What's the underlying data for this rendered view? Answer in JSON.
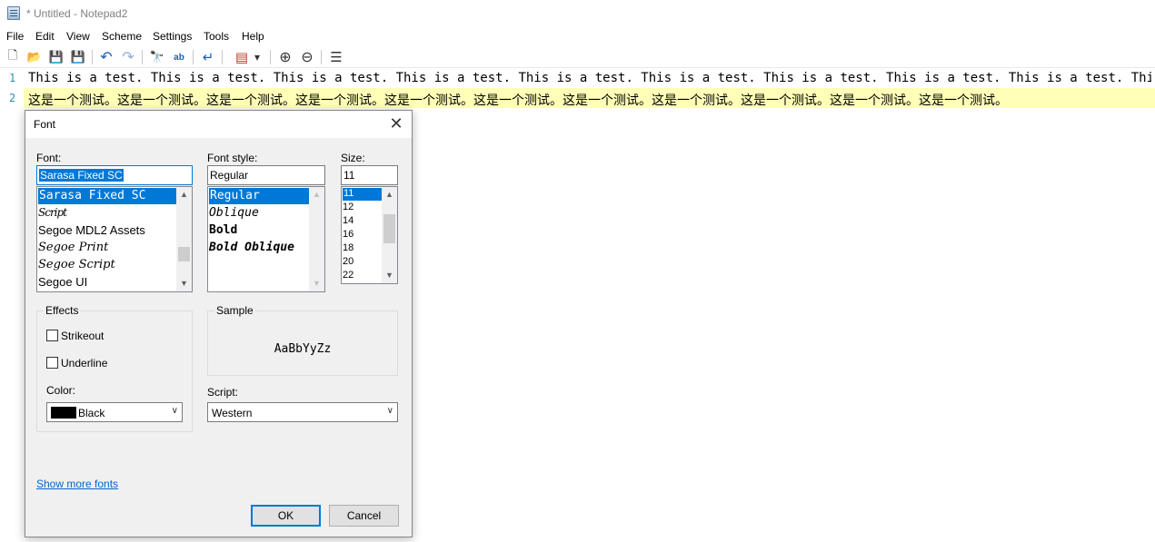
{
  "window": {
    "title": "* Untitled - Notepad2",
    "icon": "notepad-icon"
  },
  "menu": [
    "File",
    "Edit",
    "View",
    "Scheme",
    "Settings",
    "Tools",
    "Help"
  ],
  "toolbar": {
    "buttons": [
      {
        "name": "new-file-button",
        "icon": "new-file-icon",
        "glyph": "🗋"
      },
      {
        "name": "open-file-button",
        "icon": "open-folder-icon",
        "glyph": "📂"
      },
      {
        "name": "save-button",
        "icon": "save-icon",
        "glyph": "💾"
      },
      {
        "name": "save-as-button",
        "icon": "save-as-icon",
        "glyph": "💾"
      },
      {
        "name": "undo-button",
        "icon": "undo-icon",
        "glyph": "↶"
      },
      {
        "name": "redo-button",
        "icon": "redo-icon",
        "glyph": "↷"
      },
      {
        "name": "find-button",
        "icon": "binoculars-icon",
        "glyph": "🔭"
      },
      {
        "name": "replace-button",
        "icon": "replace-icon",
        "glyph": "ab"
      },
      {
        "name": "word-wrap-button",
        "icon": "word-wrap-icon",
        "glyph": "↵"
      },
      {
        "name": "scheme-button",
        "icon": "scheme-icon",
        "glyph": "▤"
      },
      {
        "name": "scheme-dropdown-button",
        "icon": "chevron-down-icon",
        "glyph": "▾"
      },
      {
        "name": "zoom-in-button",
        "icon": "zoom-in-icon",
        "glyph": "⊕"
      },
      {
        "name": "zoom-out-button",
        "icon": "zoom-out-icon",
        "glyph": "⊖"
      },
      {
        "name": "view-button",
        "icon": "list-icon",
        "glyph": "☰"
      }
    ]
  },
  "editor": {
    "line_numbers": [
      "1",
      "2"
    ],
    "lines": [
      "This is a test. This is a test. This is a test. This is a test. This is a test. This is a test. This is a test. This is a test. This is a test. This is a",
      "这是一个测试。这是一个测试。这是一个测试。这是一个测试。这是一个测试。这是一个测试。这是一个测试。这是一个测试。这是一个测试。这是一个测试。这是一个测试。"
    ],
    "current_line_color": "#ffffb8"
  },
  "font_dialog": {
    "title": "Font",
    "font_label": "Font:",
    "font_value": "Sarasa Fixed SC",
    "font_list": [
      "Sarasa Fixed SC",
      "Script",
      "Segoe MDL2 Assets",
      "Segoe Print",
      "Segoe Script",
      "Segoe UI"
    ],
    "style_label": "Font style:",
    "style_value": "Regular",
    "style_list": [
      "Regular",
      "Oblique",
      "Bold",
      "Bold Oblique"
    ],
    "size_label": "Size:",
    "size_value": "11",
    "size_list": [
      "11",
      "12",
      "14",
      "16",
      "18",
      "20",
      "22"
    ],
    "effects_label": "Effects",
    "strikeout_label": "Strikeout",
    "underline_label": "Underline",
    "color_label": "Color:",
    "color_value": "Black",
    "sample_label": "Sample",
    "sample_text": "AaBbYyZz",
    "script_label": "Script:",
    "script_value": "Western",
    "more_fonts_link": "Show more fonts",
    "ok_label": "OK",
    "cancel_label": "Cancel",
    "accent_color": "#0078d7"
  }
}
